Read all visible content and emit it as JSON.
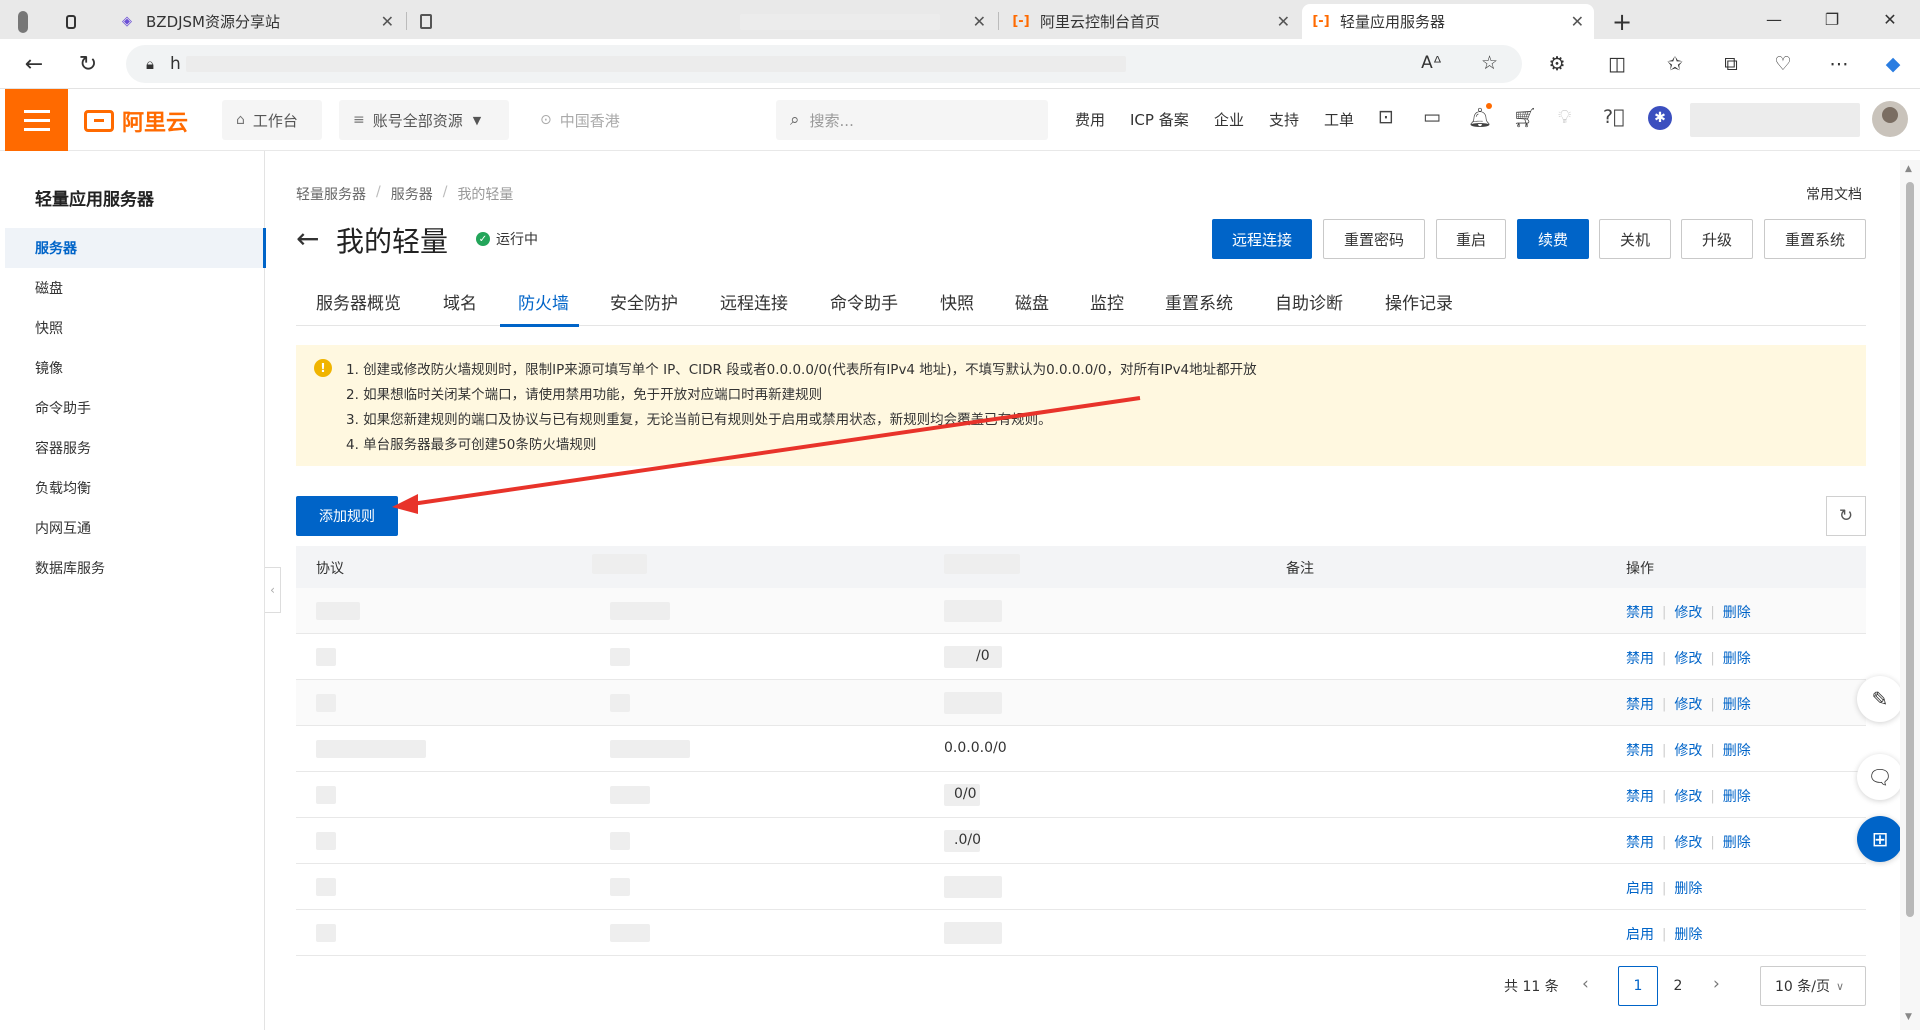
{
  "browser": {
    "tabs": [
      {
        "title": "",
        "icon": "profile-icon"
      },
      {
        "title": "BZDJSM资源分享站",
        "icon": "cube-icon"
      },
      {
        "title": "",
        "icon": "page-icon"
      },
      {
        "title": "阿里云控制台首页",
        "icon": "aliyun-icon"
      },
      {
        "title": "轻量应用服务器",
        "icon": "aliyun-icon"
      }
    ],
    "new_tab": "+",
    "url_prefix": "h",
    "window_controls": [
      "—",
      "❐",
      "✕"
    ]
  },
  "topnav": {
    "logo_text": "阿里云",
    "workbench": "工作台",
    "account_scope": "账号全部资源",
    "region": "中国香港",
    "search_placeholder": "搜索...",
    "links": [
      "费用",
      "ICP 备案",
      "企业",
      "支持",
      "工单"
    ]
  },
  "sidebar": {
    "title": "轻量应用服务器",
    "items": [
      "服务器",
      "磁盘",
      "快照",
      "镜像",
      "命令助手",
      "容器服务",
      "负载均衡",
      "内网互通",
      "数据库服务"
    ],
    "active_index": 0
  },
  "header": {
    "breadcrumb": [
      "轻量服务器",
      "服务器",
      "我的轻量"
    ],
    "doc_link": "常用文档",
    "title": "我的轻量",
    "status": "运行中",
    "actions": [
      "远程连接",
      "重置密码",
      "重启",
      "续费",
      "关机",
      "升级",
      "重置系统"
    ]
  },
  "tabs": {
    "items": [
      "服务器概览",
      "域名",
      "防火墙",
      "安全防护",
      "远程连接",
      "命令助手",
      "快照",
      "磁盘",
      "监控",
      "重置系统",
      "自助诊断",
      "操作记录"
    ],
    "active_index": 2
  },
  "notice": {
    "lines": [
      "1. 创建或修改防火墙规则时，限制IP来源可填写单个 IP、CIDR 段或者0.0.0.0/0(代表所有IPv4 地址)，不填写默认为0.0.0.0/0，对所有IPv4地址都开放",
      "2. 如果想临时关闭某个端口，请使用禁用功能，免于开放对应端口时再新建规则",
      "3. 如果您新建规则的端口及协议与已有规则重复，无论当前已有规则处于启用或禁用状态，新规则均会覆盖已有规则。",
      "4. 单台服务器最多可创建50条防火墙规则"
    ]
  },
  "toolbar": {
    "add_rule": "添加规则"
  },
  "table": {
    "headers": {
      "protocol": "协议",
      "remark": "备注",
      "operations": "操作"
    },
    "rows": [
      {
        "source": "",
        "ops": [
          "禁用",
          "修改",
          "删除"
        ]
      },
      {
        "source": "/0",
        "ops": [
          "禁用",
          "修改",
          "删除"
        ]
      },
      {
        "source": "",
        "ops": [
          "禁用",
          "修改",
          "删除"
        ]
      },
      {
        "source": "0.0.0.0/0",
        "ops": [
          "禁用",
          "修改",
          "删除"
        ]
      },
      {
        "source": "0/0",
        "ops": [
          "禁用",
          "修改",
          "删除"
        ]
      },
      {
        "source": ".0/0",
        "ops": [
          "禁用",
          "修改",
          "删除"
        ]
      },
      {
        "source": "",
        "ops": [
          "启用",
          "删除"
        ]
      },
      {
        "source": "",
        "ops": [
          "启用",
          "删除"
        ]
      }
    ]
  },
  "pagination": {
    "total": "共 11 条",
    "pages": [
      "1",
      "2"
    ],
    "current": "1",
    "page_size": "10 条/页"
  },
  "colors": {
    "brand": "#ff6a00",
    "primary": "#0064c8",
    "notice_bg": "#fff8e0",
    "arrow": "#e8332a"
  }
}
